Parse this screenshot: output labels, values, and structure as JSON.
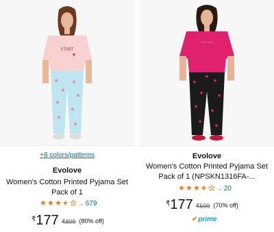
{
  "products": [
    {
      "colors_link": "+8 colors/patterns",
      "brand": "Evolove",
      "title_line1": "Women's Cotton Printed Pyjama Set",
      "title_line2": "Pack of 1",
      "rating": 3.5,
      "rating_count": "679",
      "currency": "₹",
      "price": "177",
      "mrp": "₹899",
      "discount": "(80% off)",
      "colors": {
        "top": "#f7d2d0",
        "bottom": "#bfe6f0"
      }
    },
    {
      "brand": "Evolove",
      "title_line1": "Women's Cotton Printed Pyjama Set",
      "title_line2": "Pack of 1 (NPSKN1316FA-...",
      "rating": 3.5,
      "rating_count": "20",
      "currency": "₹",
      "price": "177",
      "mrp": "₹599",
      "discount": "(70% off)",
      "prime": "prime",
      "colors": {
        "top": "#e0226e",
        "bottom": "#1b1b1b"
      }
    }
  ],
  "colors": {
    "link": "#007185",
    "star": "#de7921",
    "prime": "#00a8e1"
  },
  "icons": [
    "star-icon",
    "chevron-down-icon",
    "prime-check-icon"
  ]
}
